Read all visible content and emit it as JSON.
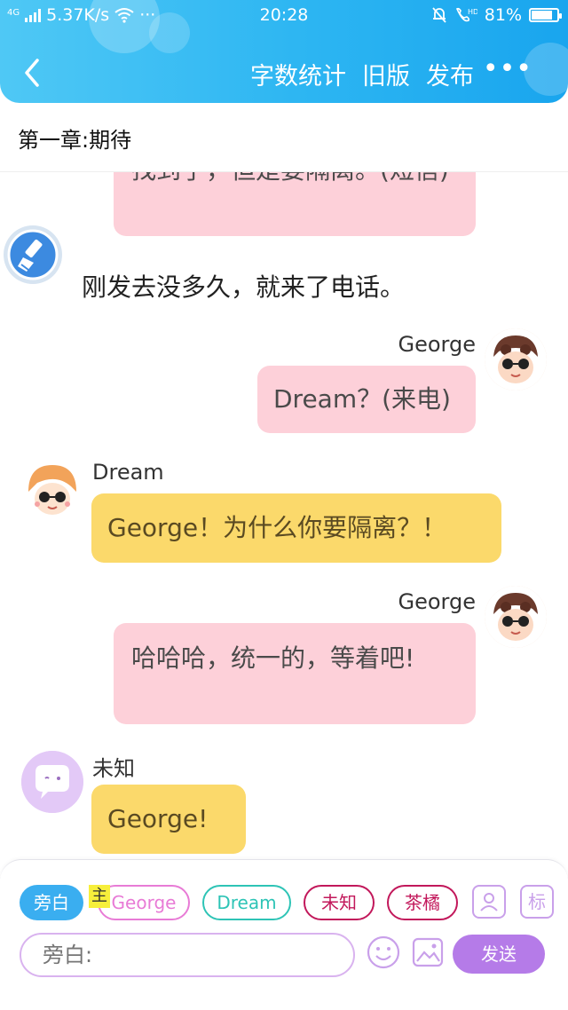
{
  "status_bar": {
    "network_type": "4G",
    "speed": "5.37K/s",
    "more": "···",
    "time": "20:28",
    "battery": "81%",
    "battery_level": 0.81
  },
  "header": {
    "actions": [
      "字数统计",
      "旧版",
      "发布"
    ],
    "more": "•••"
  },
  "chapter_title": "第一章:期待",
  "messages": {
    "top_cut": "找到了，但是要隔离。(短信)",
    "narration": "刚发去没多久，就来了电话。",
    "m1": {
      "speaker": "George",
      "text": "Dream？(来电)"
    },
    "m2": {
      "speaker": "Dream",
      "text": "George！为什么你要隔离？！"
    },
    "m3": {
      "speaker": "George",
      "text": "哈哈哈，统一的，等着吧!"
    },
    "m4": {
      "speaker": "未知",
      "text": "George!"
    }
  },
  "composer": {
    "chips": [
      "旁白",
      "George",
      "Dream",
      "未知",
      "茶橘"
    ],
    "main_mark": "主",
    "mark_label": "标",
    "input_placeholder": "旁白:",
    "send_label": "发送"
  },
  "colors": {
    "header_gradient": [
      "#4fc8f5",
      "#19a5ee"
    ],
    "pink_bubble": "#fdd0d9",
    "yellow_bubble": "#fbd96b",
    "send_button": "#b57be8"
  }
}
